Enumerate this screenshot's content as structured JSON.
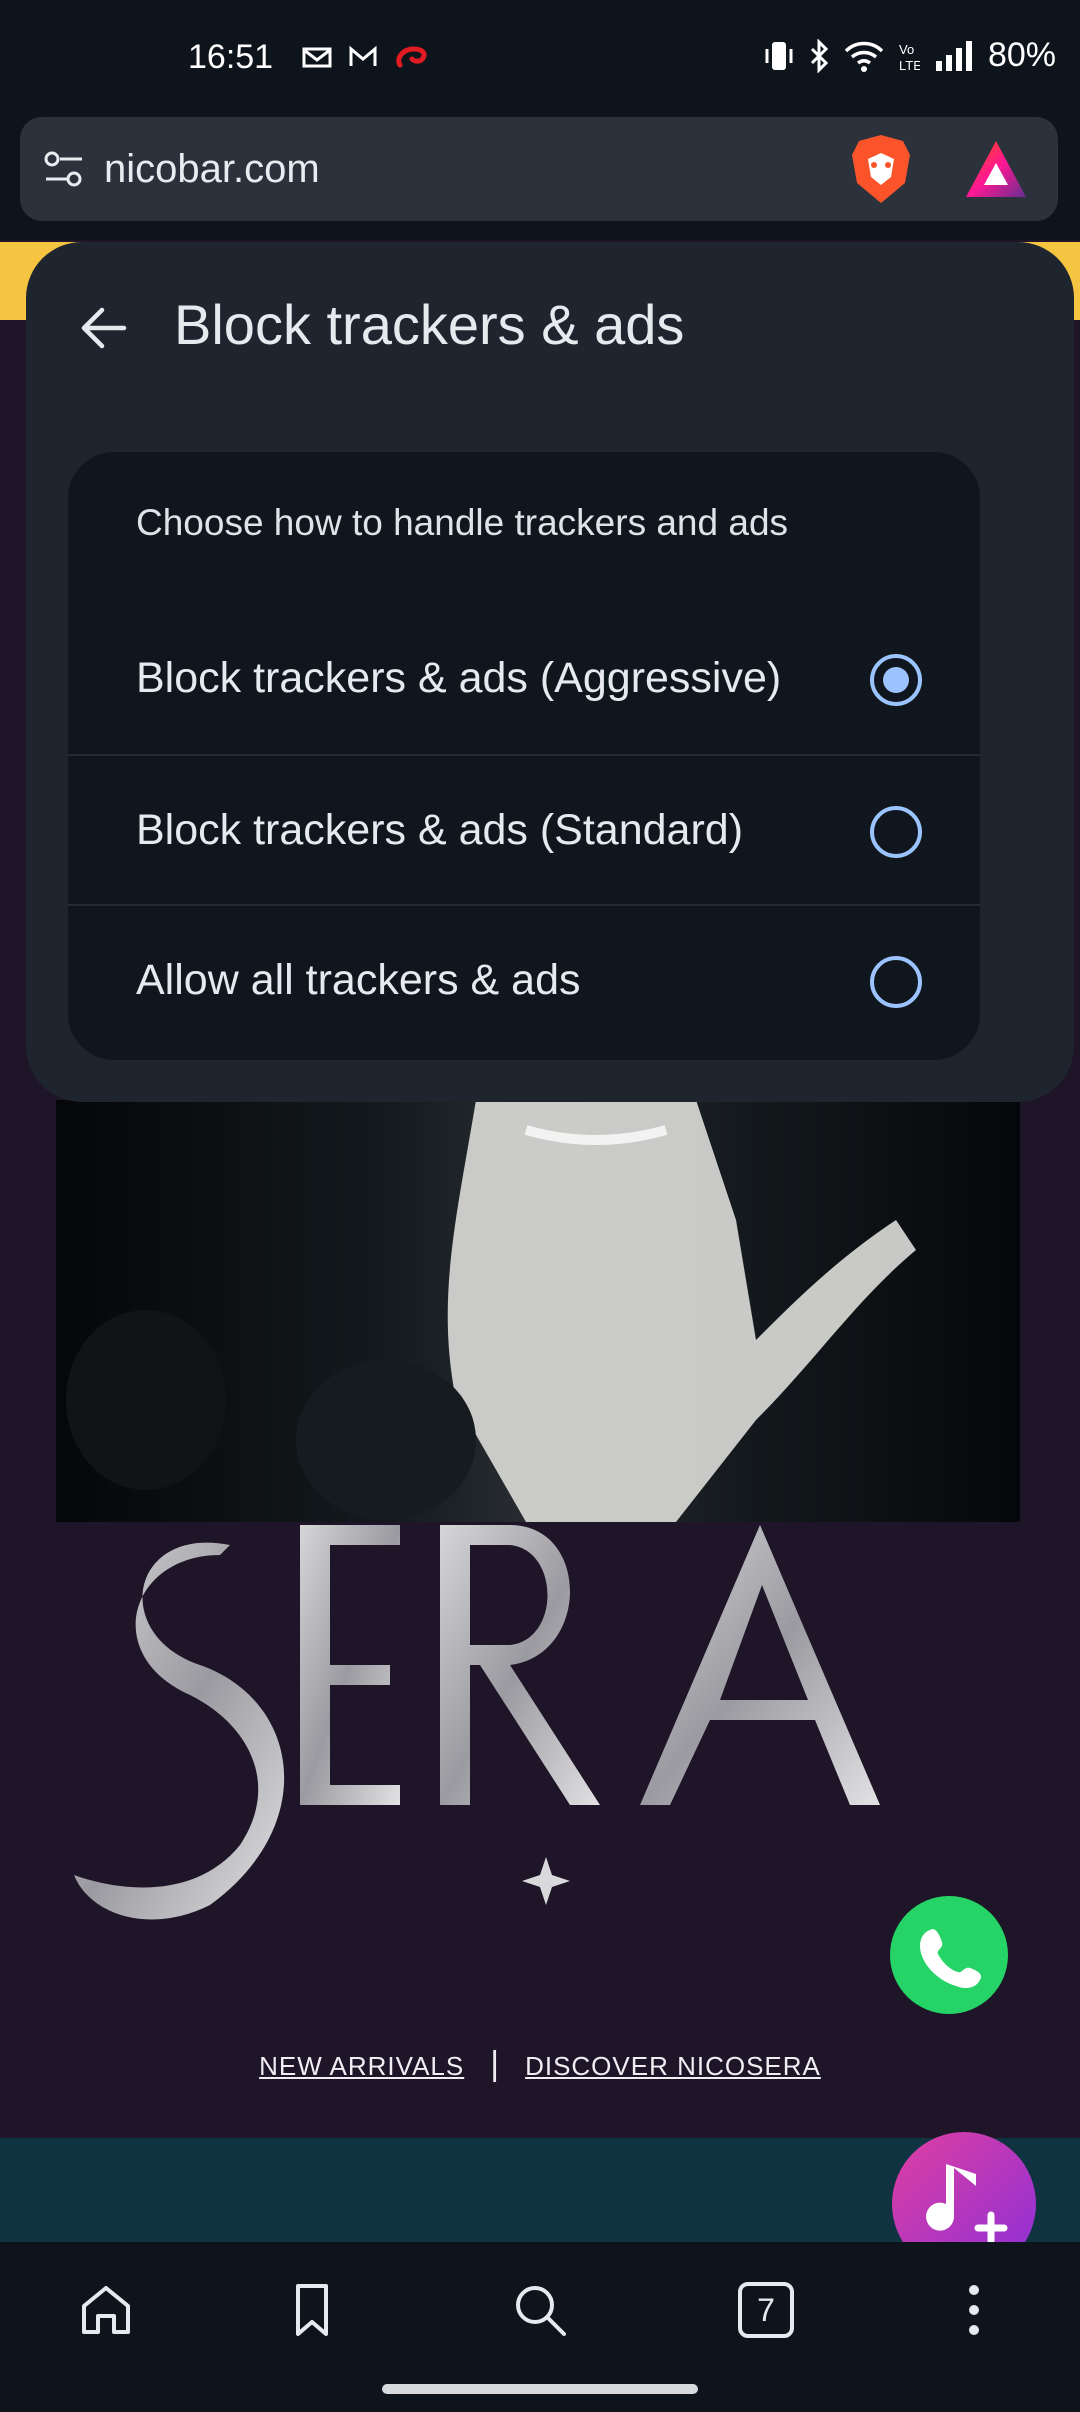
{
  "status_bar": {
    "time": "16:51",
    "notification_icons": [
      "gmail-icon",
      "gmail-icon",
      "airtel-icon"
    ],
    "system_icons": [
      "vibrate-icon",
      "bluetooth-icon",
      "wifi-icon",
      "volte-icon",
      "signal-icon"
    ],
    "battery": "80%"
  },
  "browser": {
    "url": "nicobar.com",
    "toolbar_icons": [
      "site-settings-icon",
      "brave-shields-icon",
      "brave-rewards-icon"
    ]
  },
  "sheet": {
    "title": "Block trackers & ads",
    "subtitle": "Choose how to handle trackers and ads",
    "options": [
      {
        "label": "Block trackers & ads (Aggressive)",
        "selected": true
      },
      {
        "label": "Block trackers & ads (Standard)",
        "selected": false
      },
      {
        "label": "Allow all trackers & ads",
        "selected": false
      }
    ]
  },
  "page": {
    "logo_text": "SERA",
    "links": [
      "NEW ARRIVALS",
      "|",
      "DISCOVER NICOSERA"
    ]
  },
  "bottom_nav": {
    "items": [
      "home-icon",
      "bookmarks-icon",
      "search-icon",
      "tabs-icon",
      "more-menu-icon"
    ],
    "tab_count": "7"
  },
  "colors": {
    "accent": "#9cc2ff",
    "sheet_bg": "#1e252e",
    "card_bg": "#10161d",
    "site_bg": "#1f1528",
    "banner": "#f5c542"
  }
}
